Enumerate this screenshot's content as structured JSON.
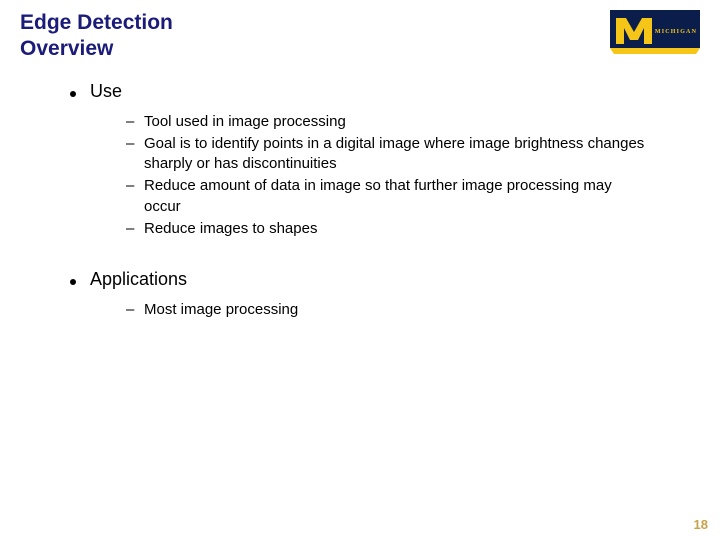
{
  "title_line1": "Edge Detection",
  "title_line2": "Overview",
  "logo": {
    "name": "michigan-logo",
    "text": "MICHIGAN",
    "colors": {
      "navy": "#0b1e4b",
      "maize": "#f5c518"
    }
  },
  "sections": [
    {
      "heading": "Use",
      "items": [
        "Tool used in image processing",
        "Goal is to identify points in a digital image where image brightness changes sharply or has discontinuities",
        "Reduce amount of data in image so that further image processing may occur",
        "Reduce images to shapes"
      ]
    },
    {
      "heading": "Applications",
      "items": [
        "Most image processing"
      ]
    }
  ],
  "page_number": "18"
}
